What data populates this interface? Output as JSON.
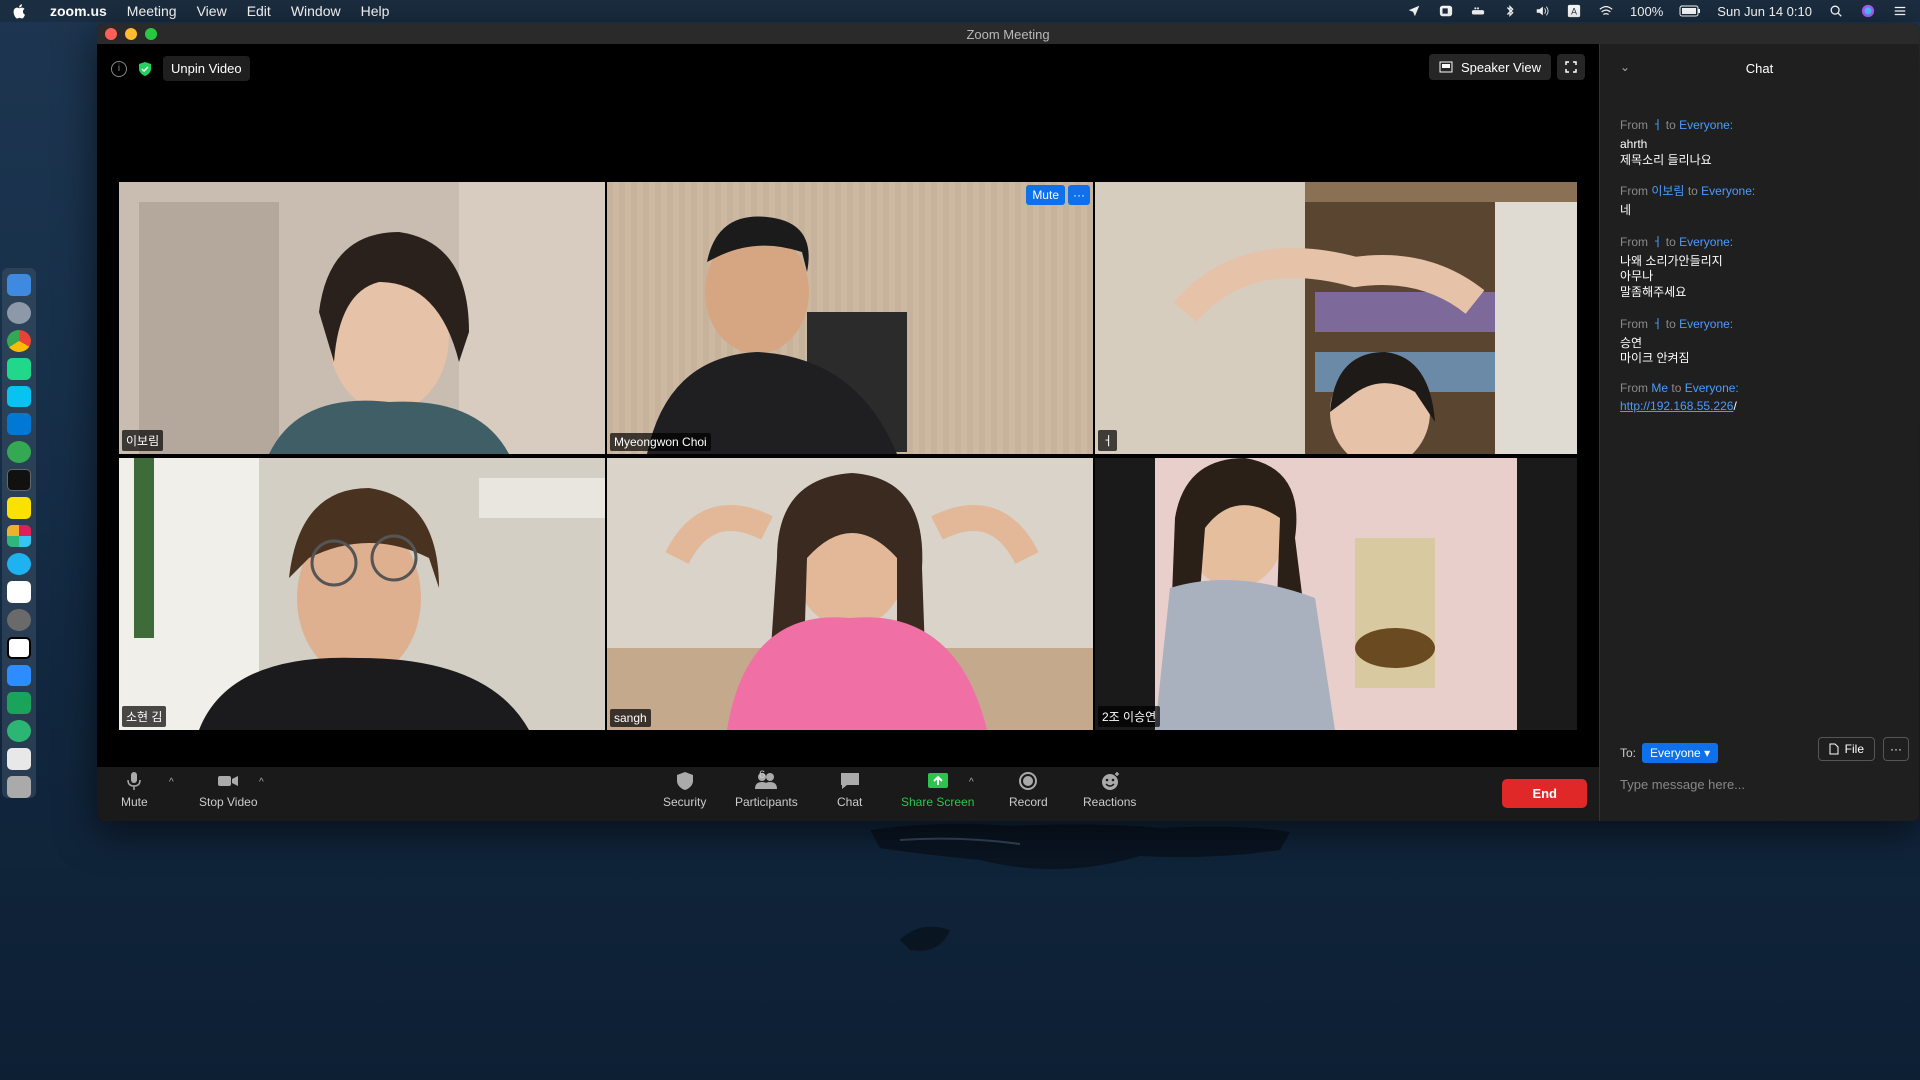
{
  "menubar": {
    "app_name": "zoom.us",
    "items": [
      "Meeting",
      "View",
      "Edit",
      "Window",
      "Help"
    ],
    "battery": "100%",
    "datetime": "Sun Jun 14  0:10"
  },
  "window": {
    "title": "Zoom Meeting"
  },
  "meeting_top": {
    "unpin_label": "Unpin Video",
    "speaker_view_label": "Speaker View"
  },
  "tiles": [
    {
      "name": "이보림",
      "active": true
    },
    {
      "name": "Myeongwon Choi",
      "mute_label": "Mute",
      "more_label": "···"
    },
    {
      "name": "ㅓ"
    },
    {
      "name": "소현 김"
    },
    {
      "name": "sangh"
    },
    {
      "name": "2조 이승연"
    }
  ],
  "toolbar": {
    "mute": "Mute",
    "stop_video": "Stop Video",
    "security": "Security",
    "participants": "Participants",
    "participants_count": "6",
    "chat": "Chat",
    "share_screen": "Share Screen",
    "record": "Record",
    "reactions": "Reactions",
    "end": "End"
  },
  "chat": {
    "title": "Chat",
    "messages": [
      {
        "from_prefix": "From",
        "sender": "ㅓ",
        "to_word": "to",
        "recipient": "Everyone:",
        "lines": [
          "ahrth",
          "제목소리 들리나요"
        ]
      },
      {
        "from_prefix": "From",
        "sender": "이보림",
        "to_word": "to",
        "recipient": "Everyone:",
        "lines": [
          "네"
        ]
      },
      {
        "from_prefix": "From",
        "sender": "ㅓ",
        "to_word": "to",
        "recipient": "Everyone:",
        "lines": [
          "나왜 소리가안들리지",
          "아무나",
          "말좀해주세요"
        ]
      },
      {
        "from_prefix": "From",
        "sender": "ㅓ",
        "to_word": "to",
        "recipient": "Everyone:",
        "lines": [
          "승연",
          "마이크 안켜짐"
        ]
      },
      {
        "from_prefix": "From",
        "sender": "Me",
        "to_word": "to",
        "recipient": "Everyone:",
        "link": "http://192.168.55.226",
        "link_suffix": "/"
      }
    ],
    "to_label": "To:",
    "to_value": "Everyone",
    "file_label": "File",
    "more_label": "···",
    "input_placeholder": "Type message here..."
  },
  "colors": {
    "accent_blue": "#0e71eb",
    "end_red": "#e02828",
    "share_green": "#2dc44d",
    "active_speaker": "#e2e27a"
  }
}
